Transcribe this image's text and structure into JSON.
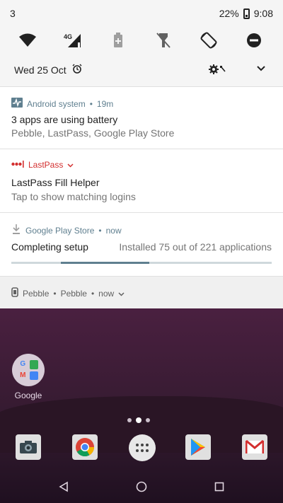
{
  "status": {
    "notif_count": "3",
    "battery": "22%",
    "time": "9:08"
  },
  "quick_settings": {
    "tiles": [
      {
        "name": "wifi-icon"
      },
      {
        "name": "cellular-4g-icon",
        "label": "4G"
      },
      {
        "name": "battery-saver-icon"
      },
      {
        "name": "flashlight-icon"
      },
      {
        "name": "auto-rotate-icon"
      },
      {
        "name": "do-not-disturb-icon"
      }
    ],
    "date": "Wed 25 Oct"
  },
  "notifications": {
    "android": {
      "app": "Android system",
      "time": "19m",
      "title": "3 apps are using battery",
      "body": "Pebble, LastPass, Google Play Store"
    },
    "lastpass": {
      "app": "LastPass",
      "title": "LastPass Fill Helper",
      "body": "Tap to show matching logins"
    },
    "play": {
      "app": "Google Play Store",
      "time": "now",
      "title": "Completing setup",
      "status": "Installed 75 out of 221 applications",
      "progress": 0.34
    },
    "pebble": {
      "app": "Pebble",
      "sub": "Pebble",
      "time": "now"
    }
  },
  "home": {
    "folder_label": "Google",
    "dock": [
      "camera",
      "chrome",
      "app-drawer",
      "play-store",
      "gmail"
    ]
  },
  "colors": {
    "accent": "#5f7f8f",
    "lastpass_red": "#d32f2f"
  }
}
